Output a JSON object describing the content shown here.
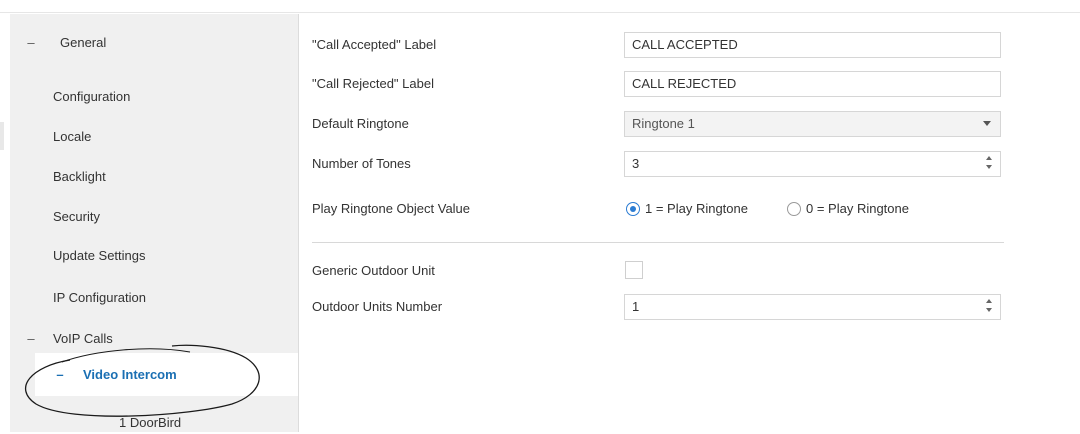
{
  "sidebar": {
    "general": {
      "glyph": "–",
      "label": "General"
    },
    "items": [
      {
        "label": "Configuration"
      },
      {
        "label": "Locale"
      },
      {
        "label": "Backlight"
      },
      {
        "label": "Security"
      },
      {
        "label": "Update Settings"
      },
      {
        "label": "IP Configuration"
      }
    ],
    "voip": {
      "glyph": "–",
      "label": "VoIP Calls"
    },
    "video_intercom": {
      "glyph": "–",
      "label": "Video Intercom"
    },
    "doorbird": {
      "label": "1 DoorBird"
    }
  },
  "form": {
    "call_accepted": {
      "label": "\"Call Accepted\" Label",
      "value": "CALL ACCEPTED"
    },
    "call_rejected": {
      "label": "\"Call Rejected\" Label",
      "value": "CALL REJECTED"
    },
    "default_ringtone": {
      "label": "Default Ringtone",
      "value": "Ringtone 1"
    },
    "number_of_tones": {
      "label": "Number of Tones",
      "value": "3"
    },
    "play_ringtone": {
      "label": "Play Ringtone Object Value",
      "option1": "1 = Play Ringtone",
      "option2": "0 = Play Ringtone",
      "selected": "option1"
    },
    "generic_outdoor_unit": {
      "label": "Generic Outdoor Unit",
      "checked": false
    },
    "outdoor_units_number": {
      "label": "Outdoor Units Number",
      "value": "1"
    }
  },
  "colors": {
    "accent": "#2b7cd3",
    "selected_text": "#1a6fb3",
    "sidebar_bg": "#f0f0f0"
  }
}
